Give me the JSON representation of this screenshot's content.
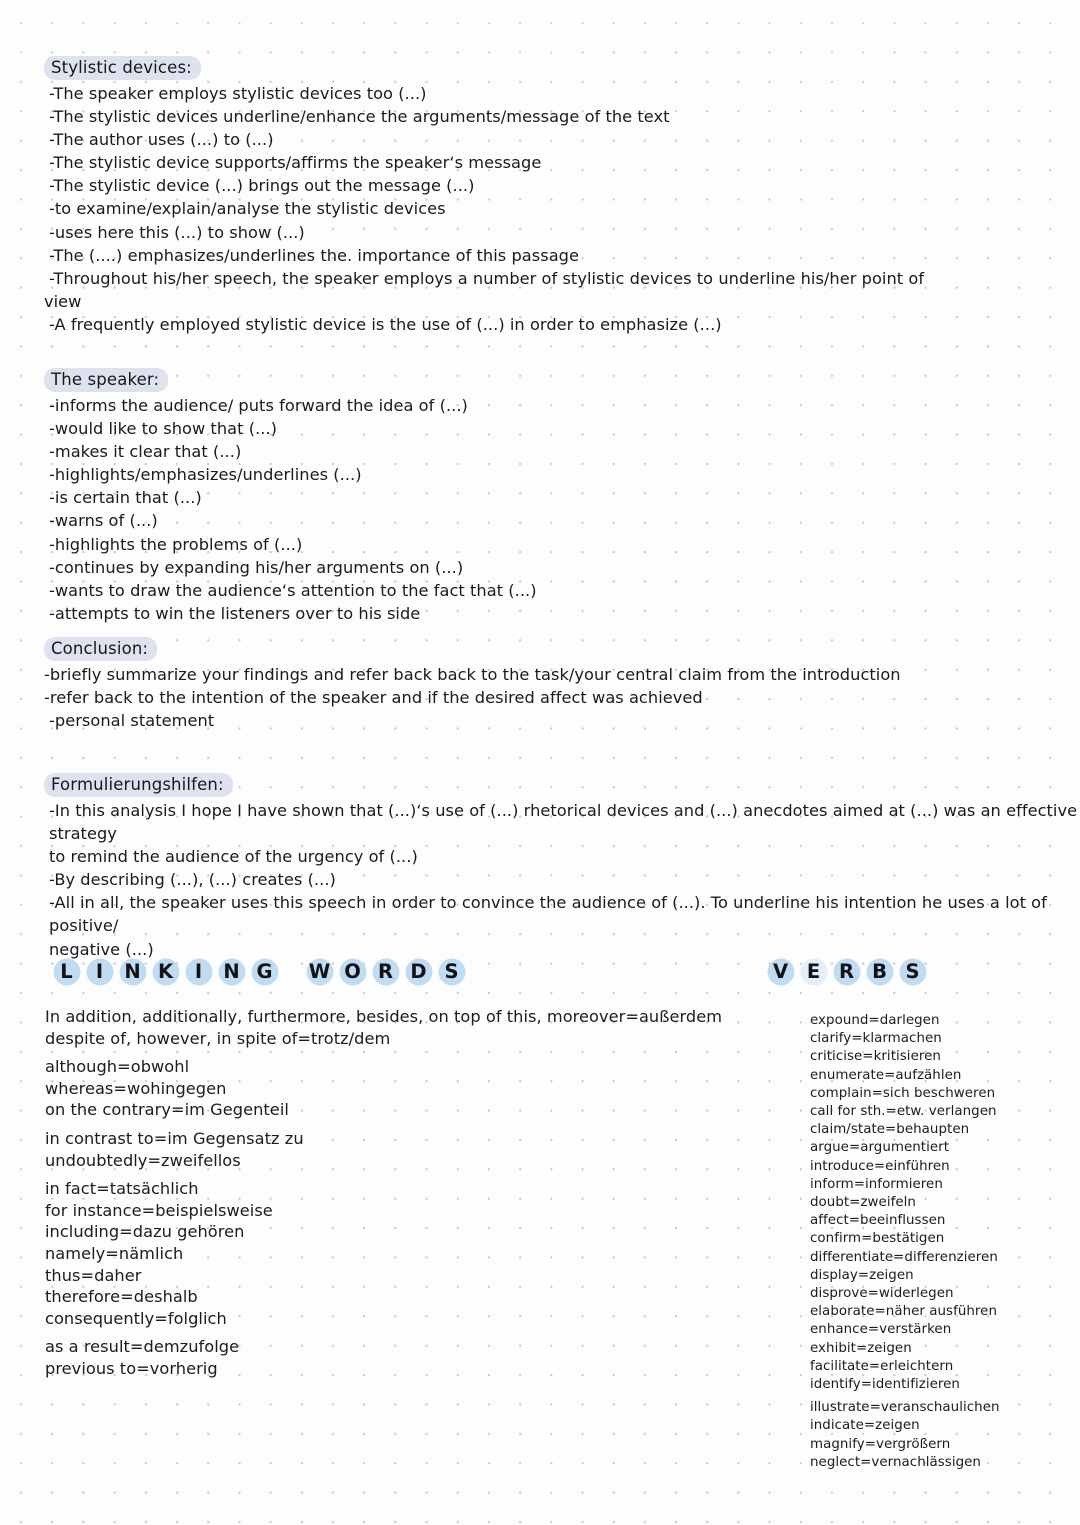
{
  "page": {
    "title": "Analysis phrases — notes sheet",
    "paper_color": "#fdfdfd",
    "dot_color": "#c9ccd6",
    "highlight_color": "#dde2ee",
    "bubble_color": "#bfdcf2",
    "ink_color": "#181a1f"
  },
  "sections": [
    {
      "heading": "Stylistic devices:",
      "lines": [
        "-The speaker employs stylistic devices too (...)",
        "-The stylistic devices underline/enhance the arguments/message of the text",
        "-The author uses (...) to (...)",
        "-The stylistic device supports/affirms the speaker‘s message",
        "-The stylistic device (...) brings out the message (...)",
        "-to examine/explain/analyse the stylistic devices",
        "-uses here this (...) to show (...)",
        "-The (....) emphasizes/underlines the. importance of this passage",
        "-Throughout his/her speech, the speaker employs a number of stylistic devices to underline his/her point of",
        "view",
        "-A frequently employed stylistic device is the use of (...) in order to emphasize (...)"
      ]
    },
    {
      "heading": "The speaker:",
      "lines": [
        "-informs the audience/ puts forward the idea of (...)",
        "-would like to show that (...)",
        "-makes it clear that (...)",
        "-highlights/emphasizes/underlines (...)",
        "-is certain that (...)",
        "-warns of (...)",
        "-highlights the problems of (...)",
        "-continues by expanding his/her arguments on (...)",
        "-wants to draw the audience‘s attention to the fact that (...)",
        "-attempts to win the listeners over to his side"
      ]
    },
    {
      "heading": "Conclusion:",
      "lines": [
        "-briefly summarize your findings and refer back back to the task/your central claim from the introduction",
        "-refer back to the intention of the speaker and if the desired affect was achieved",
        "-personal statement"
      ]
    },
    {
      "heading": "Formulierungshilfen:",
      "lines": [
        "-In this analysis I hope I have shown that (...)‘s use of (...) rhetorical devices and (...) anecdotes aimed at (...) was an effective strategy",
        "to remind the audience of the urgency of (...)",
        "-By describing (...), (...) creates (...)",
        "-All in all, the speaker uses this speech in order to convince the audience of (...). To underline his intention he uses a lot of positive/",
        "negative (...)"
      ]
    }
  ],
  "linking_words": {
    "title_letters": [
      "L",
      "I",
      "N",
      "K",
      "I",
      "N",
      "G",
      "W",
      "O",
      "R",
      "D",
      "S"
    ],
    "title_gap_after_index": 6,
    "title_text": "LINKING WORDS",
    "items": [
      "In addition, additionally, furthermore, besides, on top of this, moreover=außerdem",
      "despite of, however, in spite of=trotz/dem",
      "although=obwohl",
      "whereas=wohingegen",
      "on the contrary=im Gegenteil",
      "in contrast to=im Gegensatz zu",
      "undoubtedly=zweifellos",
      "in fact=tatsächlich",
      "for instance=beispielsweise",
      "including=dazu gehören",
      "namely=nämlich",
      "thus=daher",
      "therefore=deshalb",
      "consequently=folglich",
      "as a result=demzufolge",
      "previous to=vorherig"
    ],
    "items_extra_gap_before": [
      2,
      5,
      8,
      14
    ]
  },
  "verbs": {
    "title_letters": [
      "V",
      "E",
      "R",
      "B",
      "S"
    ],
    "title_faded_index": 1,
    "title_text": "VERBS",
    "items": [
      "expound=darlegen",
      "clarify=klarmachen",
      "criticise=kritisieren",
      "enumerate=aufzählen",
      "complain=sich beschweren",
      "call for sth.=etw. verlangen",
      "claim/state=behaupten",
      "argue=argumentiert",
      "introduce=einführen",
      "inform=informieren",
      "doubt=zweifeln",
      "affect=beeinflussen",
      "confirm=bestätigen",
      "differentiate=differenzieren",
      "display=zeigen",
      "disprove=widerlegen",
      "elaborate=näher ausführen",
      "enhance=verstärken",
      "exhibit=zeigen",
      "facilitate=erleichtern",
      "identify=identifizieren",
      "illustrate=veranschaulichen",
      "indicate=zeigen",
      "magnify=vergrößern",
      "neglect=vernachlässigen"
    ],
    "items_extra_gap_before": [
      21
    ]
  }
}
